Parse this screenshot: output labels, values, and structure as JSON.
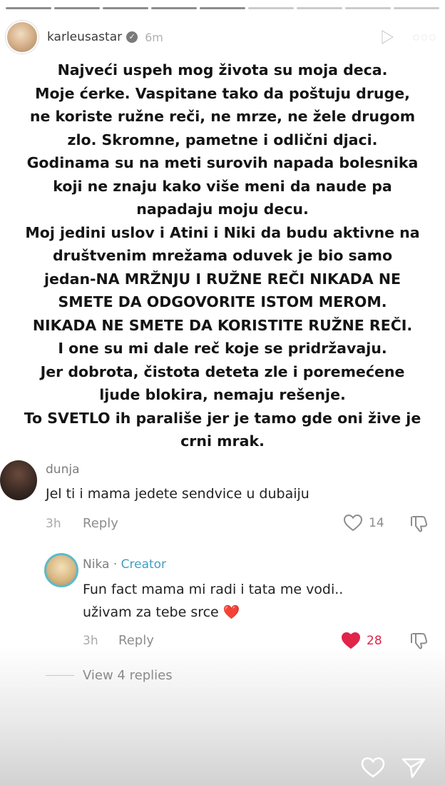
{
  "header": {
    "username": "karleusastar",
    "time": "6m",
    "progress_segments": 9,
    "progress_completed": 5
  },
  "story": {
    "lines": [
      "Najveći uspeh mog života su moja deca.",
      "Moje ćerke. Vaspitane tako da poštuju druge,",
      "ne koriste ružne reči, ne mrze, ne žele drugom",
      "zlo. Skromne, pametne i odlični djaci.",
      "Godinama su na meti surovih napada bolesnika",
      "koji ne znaju kako više meni da naude pa",
      "napadaju moju decu.",
      "Moj jedini uslov i Atini i Niki da budu aktivne na",
      "društvenim mrežama oduvek je bio samo",
      "jedan-NA MRŽNJU I RUŽNE REČI NIKADA NE",
      "SMETE DA ODGOVORITE ISTOM MEROM.",
      "NIKADA NE SMETE DA KORISTITE RUŽNE REČI.",
      "I one su mi dale reč koje se pridržavaju.",
      "Jer dobrota, čistota deteta zle i poremećene",
      "ljude blokira, nemaju rešenje.",
      "To SVETLO ih parališe jer je tamo gde oni žive je",
      "crni mrak."
    ]
  },
  "comments": [
    {
      "user": "dunja",
      "text_lines": [
        "Jel ti i mama jedete sendvice u dubaiju"
      ],
      "time": "3h",
      "reply_label": "Reply",
      "likes": "14"
    },
    {
      "user": "Nika",
      "separator": "·",
      "badge": "Creator",
      "text_lines": [
        "Fun fact mama mi radi i tata me vodi..",
        "uživam za tebe srce ❤️"
      ],
      "time": "3h",
      "reply_label": "Reply",
      "likes": "28"
    }
  ],
  "view_replies": "View 4 replies",
  "colors": {
    "liked_heart": "#e0244a",
    "creator_badge": "#3f9fc0",
    "creator_ring": "#5fb9c9"
  },
  "icons": [
    "play-icon",
    "more-icon",
    "heart-icon",
    "dislike-icon",
    "send-icon",
    "verified-badge-icon"
  ]
}
